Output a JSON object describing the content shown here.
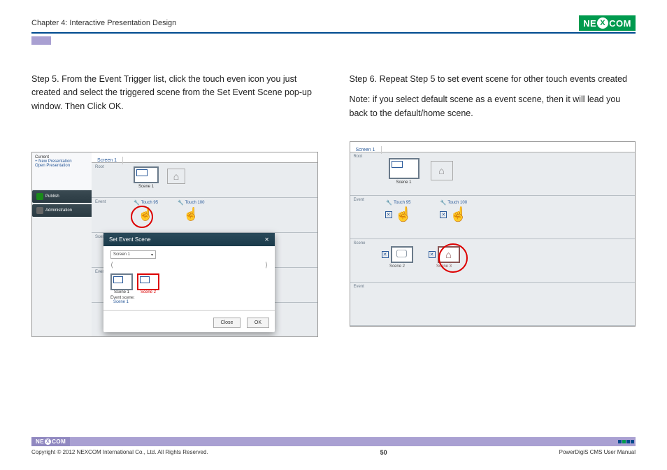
{
  "header": {
    "chapter": "Chapter 4: Interactive Presentation Design",
    "logo_left": "NE",
    "logo_x": "X",
    "logo_right": "COM"
  },
  "step5": {
    "text": "Step 5. From the Event Trigger list, click the touch even icon you just created and select the triggered scene from the Set Event Scene pop-up window. Then Click OK."
  },
  "step6": {
    "text": "Step 6. Repeat Step 5 to set event scene for other touch events created",
    "note": "Note: if you select default scene as a event scene, then it will lead you back to the default/home scene."
  },
  "left_shot": {
    "sidebar": {
      "current": "Current",
      "new_pres": "+ New Presentation",
      "open_pres": "Open Presentation",
      "publish": "Publish",
      "admin": "Administration"
    },
    "tab": "Screen 1",
    "rows": {
      "root": "Root",
      "event": "Event",
      "scene": "Scene",
      "event2": "Event"
    },
    "scene1": "Scene 1",
    "touch_a": "Touch 95",
    "touch_b": "Touch 100",
    "popup": {
      "title": "Set Event Scene",
      "dropdown": "Screen 1",
      "scene1": "Scene 1",
      "scene2": "Scene 2",
      "event_scene_label": "Event scene:",
      "event_scene_value": "Scene 1",
      "close": "Close",
      "ok": "OK"
    }
  },
  "right_shot": {
    "tab": "Screen 1",
    "rows": {
      "root": "Root",
      "event": "Event",
      "scene": "Scene",
      "event2": "Event"
    },
    "scene1": "Scene 1",
    "touch_a": "Touch 95",
    "touch_b": "Touch 100",
    "scene2": "Scene 2",
    "scene3": "Scene 3"
  },
  "footer": {
    "logo_left": "NE",
    "logo_x": "X",
    "logo_right": "COM",
    "copyright": "Copyright © 2012 NEXCOM International Co., Ltd. All Rights Reserved.",
    "page_number": "50",
    "manual": "PowerDigiS CMS User Manual"
  }
}
